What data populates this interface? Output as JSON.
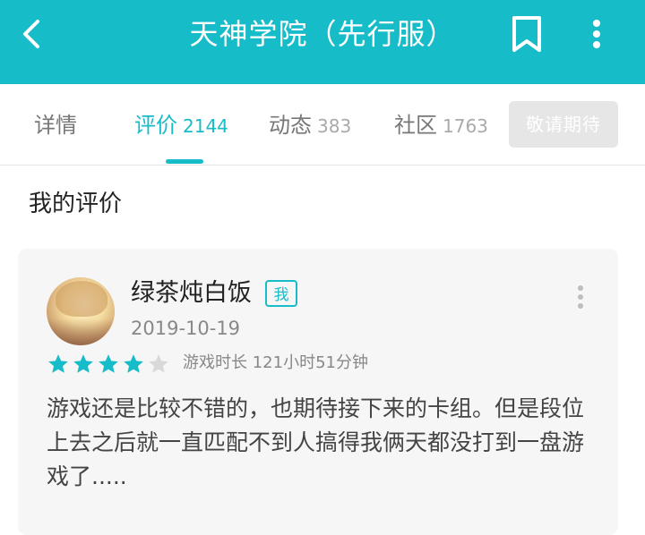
{
  "header": {
    "title": "天神学院（先行服）",
    "background_color": "#17bcc9",
    "icons": [
      "back-arrow-icon",
      "bookmark-icon",
      "more-vertical-icon"
    ]
  },
  "tabs": [
    {
      "label": "详情",
      "count": "",
      "active": false
    },
    {
      "label": "评价",
      "count": "2144",
      "active": true
    },
    {
      "label": "动态",
      "count": "383",
      "active": false
    },
    {
      "label": "社区",
      "count": "1763",
      "active": false
    }
  ],
  "await_button": {
    "label": "敬请期待"
  },
  "section": {
    "title": "我的评价"
  },
  "review": {
    "username": "绿茶炖白饭",
    "badge": "我",
    "date": "2019-10-19",
    "rating": 4,
    "max_rating": 5,
    "playtime": "游戏时长 121小时51分钟",
    "text": "游戏还是比较不错的，也期待接下来的卡组。但是段位上去之后就一直匹配不到人搞得我俩天都没打到一盘游戏了....."
  }
}
